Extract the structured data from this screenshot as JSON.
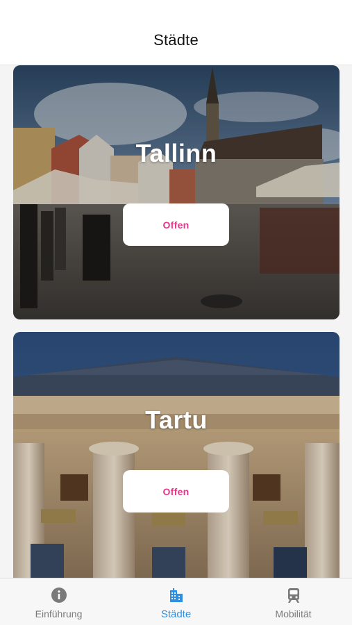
{
  "header": {
    "title": "Städte"
  },
  "cities": [
    {
      "name": "Tallinn",
      "button_label": "Offen"
    },
    {
      "name": "Tartu",
      "button_label": "Offen"
    }
  ],
  "tabbar": {
    "tabs": [
      {
        "label": "Einführung",
        "icon": "info-icon",
        "active": false
      },
      {
        "label": "Städte",
        "icon": "city-icon",
        "active": true
      },
      {
        "label": "Mobilität",
        "icon": "train-icon",
        "active": false
      }
    ]
  },
  "colors": {
    "accent": "#e8358b",
    "tab_active": "#2f8fe0",
    "tab_inactive": "#7a7a7a"
  }
}
